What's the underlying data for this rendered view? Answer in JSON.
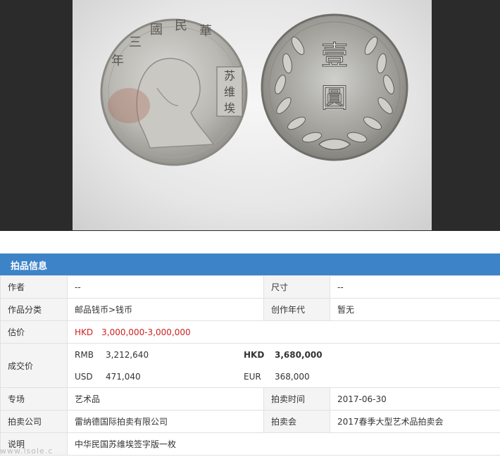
{
  "coin": {
    "obverse_legend": "中华民国三年",
    "obverse_stamp": "苏维埃",
    "reverse_denomination": "壹圆"
  },
  "section": {
    "title": "拍品信息"
  },
  "rows": {
    "author_label": "作者",
    "author_value": "--",
    "size_label": "尺寸",
    "size_value": "--",
    "category_label": "作品分类",
    "category_value": "邮品钱币>钱币",
    "year_label": "创作年代",
    "year_value": "暂无",
    "estimate_label": "估价",
    "estimate_currency": "HKD",
    "estimate_value": "3,000,000-3,000,000",
    "sold_label": "成交价",
    "sold": {
      "rmb_cur": "RMB",
      "rmb_val": "3,212,640",
      "hkd_cur": "HKD",
      "hkd_val": "3,680,000",
      "usd_cur": "USD",
      "usd_val": "471,040",
      "eur_cur": "EUR",
      "eur_val": "368,000"
    },
    "special_label": "专场",
    "special_value": "艺术品",
    "time_label": "拍卖时间",
    "time_value": "2017-06-30",
    "company_label": "拍卖公司",
    "company_value": "雷纳德国际拍卖有限公司",
    "auction_label": "拍卖会",
    "auction_value": "2017春季大型艺术品拍卖会",
    "desc_label": "说明",
    "desc_value": "中华民国苏维埃签字版一枚"
  },
  "colors": {
    "header_bg": "#3d83c8",
    "estimate_red": "#cc2222"
  },
  "watermark": "www.lsole.c"
}
